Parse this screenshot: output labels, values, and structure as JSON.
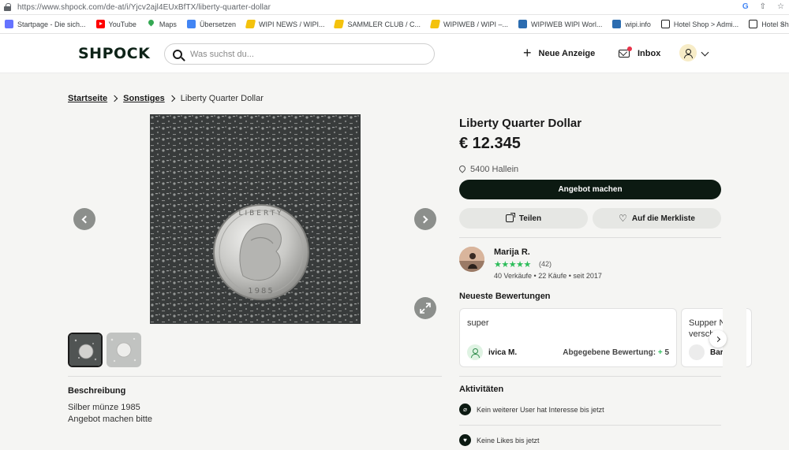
{
  "browser": {
    "url": "https://www.shpock.com/de-at/i/Yjcv2ajl4EUxBfTX/liberty-quarter-dollar"
  },
  "bookmarks": [
    {
      "label": "Startpage - Die sich...",
      "icon": "startpage-icon"
    },
    {
      "label": "YouTube",
      "icon": "youtube-icon"
    },
    {
      "label": "Maps",
      "icon": "maps-icon"
    },
    {
      "label": "Übersetzen",
      "icon": "translate-icon"
    },
    {
      "label": "WIPI NEWS / WIPI...",
      "icon": "wipi-icon"
    },
    {
      "label": "SAMMLER CLUB / C...",
      "icon": "wipi-icon"
    },
    {
      "label": "WIPIWEB / WIPI –...",
      "icon": "wipi-icon"
    },
    {
      "label": "WIPIWEB WIPI Worl...",
      "icon": "wipi-icon"
    },
    {
      "label": "wipi.info",
      "icon": "info-icon"
    },
    {
      "label": "Hotel Shop > Admi...",
      "icon": "check-icon"
    },
    {
      "label": "Hotel Shop",
      "icon": "check-icon"
    }
  ],
  "header": {
    "logo": "SHPOCK",
    "search_placeholder": "Was suchst du...",
    "new_listing": "Neue Anzeige",
    "inbox": "Inbox"
  },
  "breadcrumb": {
    "home": "Startseite",
    "category": "Sonstiges",
    "current": "Liberty Quarter Dollar"
  },
  "listing": {
    "title": "Liberty Quarter Dollar",
    "price": "€ 12.345",
    "location": "5400 Hallein",
    "offer_button": "Angebot machen",
    "share_button": "Teilen",
    "watchlist_button": "Auf die Merkliste",
    "description_title": "Beschreibung",
    "description_lines": [
      "Silber münze 1985",
      "Angebot machen bitte"
    ],
    "coin_year": "1985"
  },
  "seller": {
    "name": "Marija R.",
    "stars": "★★★★★",
    "rating_count": "(42)",
    "stats": "40 Verkäufe • 22 Käufe • seit 2017"
  },
  "reviews": {
    "title": "Neueste Bewertungen",
    "items": [
      {
        "text": "super",
        "reviewer": "ivica M.",
        "rating_label": "Abgegebene Bewertung:",
        "rating_value": "5"
      },
      {
        "text": "Supper N... versch...",
        "reviewer": "Bari..."
      }
    ]
  },
  "activities": {
    "title": "Aktivitäten",
    "items": [
      {
        "text": "Kein weiterer User hat Interesse bis jetzt",
        "icon": "tag-icon"
      },
      {
        "text": "Keine Likes bis jetzt",
        "icon": "heart-icon"
      }
    ]
  },
  "colors": {
    "primary_button": "#0c1a12",
    "star_green": "#2dbd5a",
    "page_bg": "#f5f5f3"
  }
}
